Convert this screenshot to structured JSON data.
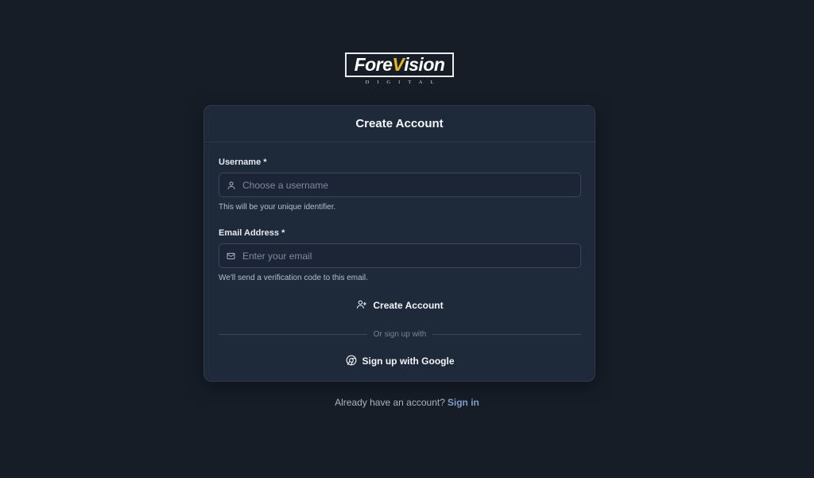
{
  "brand": {
    "name_part1": "Fore",
    "name_v": "V",
    "name_part2": "ision",
    "subtitle": "DIGITAL",
    "accent_color": "#e6b422"
  },
  "card": {
    "title": "Create Account"
  },
  "username": {
    "label": "Username *",
    "placeholder": "Choose a username",
    "value": "",
    "hint": "This will be your unique identifier.",
    "icon": "user-icon"
  },
  "email": {
    "label": "Email Address *",
    "placeholder": "Enter your email",
    "value": "",
    "hint": "We'll send a verification code to this email.",
    "icon": "mail-icon"
  },
  "actions": {
    "create_label": "Create Account",
    "create_icon": "user-plus-icon",
    "divider_text": "Or sign up with",
    "google_label": "Sign up with Google",
    "google_icon": "chrome-icon"
  },
  "footer": {
    "prompt": "Already have an account?",
    "link": "Sign in",
    "link_color": "#7f9cc4"
  }
}
